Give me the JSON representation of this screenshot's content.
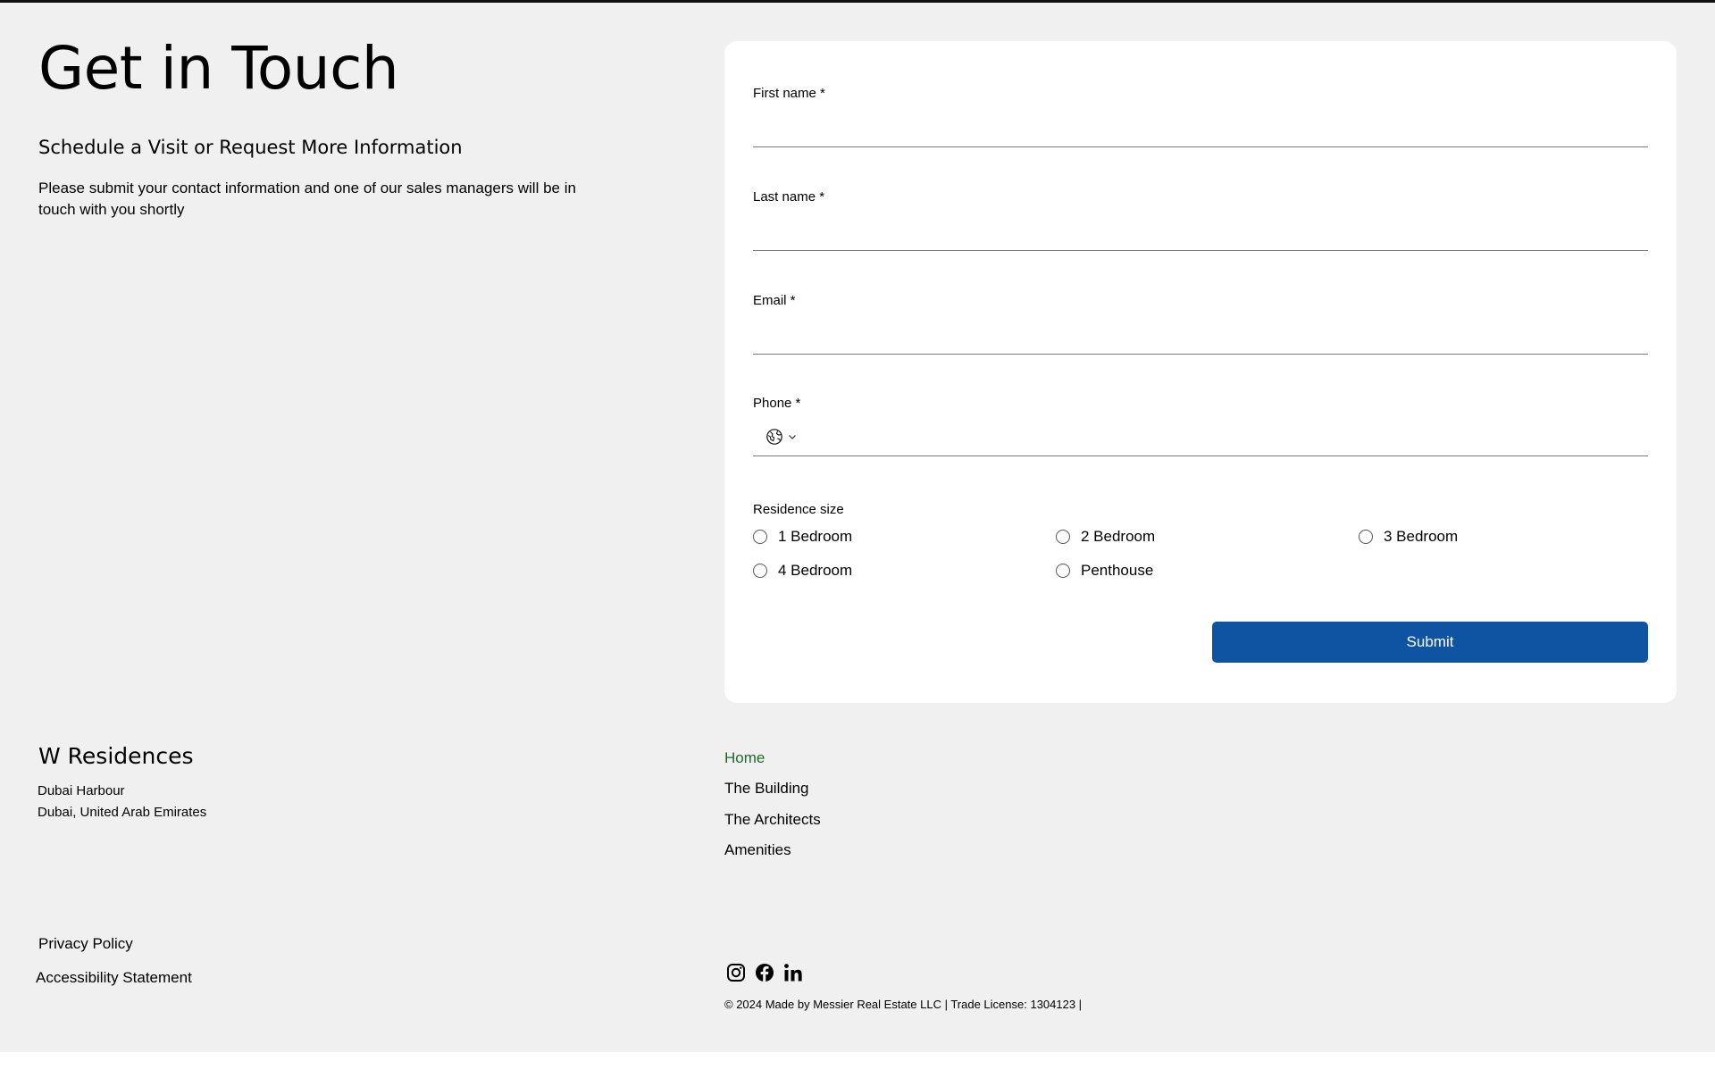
{
  "hero": {
    "title": "Get in Touch",
    "subtitle": "Schedule a Visit or Request More Information",
    "text": "Please submit your contact information and one of our sales managers will be in touch with you shortly"
  },
  "form": {
    "first_name_label": "First name *",
    "first_name_value": "",
    "last_name_label": "Last name *",
    "last_name_value": "",
    "email_label": "Email *",
    "email_value": "",
    "phone_label": "Phone *",
    "phone_value": "",
    "phone_country_icon": "globe-icon",
    "residence_label": "Residence size",
    "residence_options": [
      "1 Bedroom",
      "2 Bedroom",
      "3 Bedroom",
      "4 Bedroom",
      "Penthouse"
    ],
    "submit_label": "Submit"
  },
  "footer": {
    "brand": "W Residences",
    "address_line1": "Dubai Harbour",
    "address_line2": "Dubai, United Arab Emirates",
    "nav": [
      "Home",
      "The Building",
      "The Architects",
      "Amenities"
    ],
    "privacy": "Privacy Policy",
    "accessibility": "Accessibility Statement",
    "social": [
      "instagram-icon",
      "facebook-icon",
      "linkedin-icon"
    ],
    "copyright": "© 2024 Made by Messier Real Estate LLC | Trade License: 1304123 |"
  },
  "colors": {
    "page_bg": "#f0f0f0",
    "card_bg": "#ffffff",
    "button": "#0f54a3",
    "nav_active": "#1e6b2a"
  }
}
